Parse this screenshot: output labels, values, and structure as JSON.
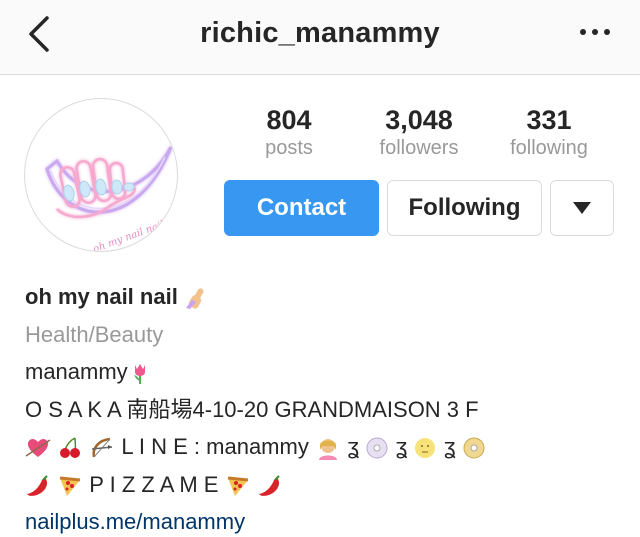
{
  "header": {
    "username": "richic_manammy"
  },
  "profile": {
    "avatar_text": "oh my nail nail",
    "stats": [
      {
        "value": "804",
        "label": "posts"
      },
      {
        "value": "3,048",
        "label": "followers"
      },
      {
        "value": "331",
        "label": "following"
      }
    ],
    "buttons": {
      "contact": "Contact",
      "following": "Following"
    }
  },
  "bio": {
    "name": "oh my nail nail",
    "category": "Health/Beauty",
    "line1": "manammy",
    "line2": "O S A K A 南船場4-10-20 GRANDMAISON 3 F",
    "line3": "L I N E : manammy",
    "line4": "P I Z Z A M E",
    "link": "nailplus.me/manammy"
  },
  "colors": {
    "accent": "#3897f0",
    "link": "#003569",
    "muted": "#999999",
    "border": "#dbdbdb"
  }
}
